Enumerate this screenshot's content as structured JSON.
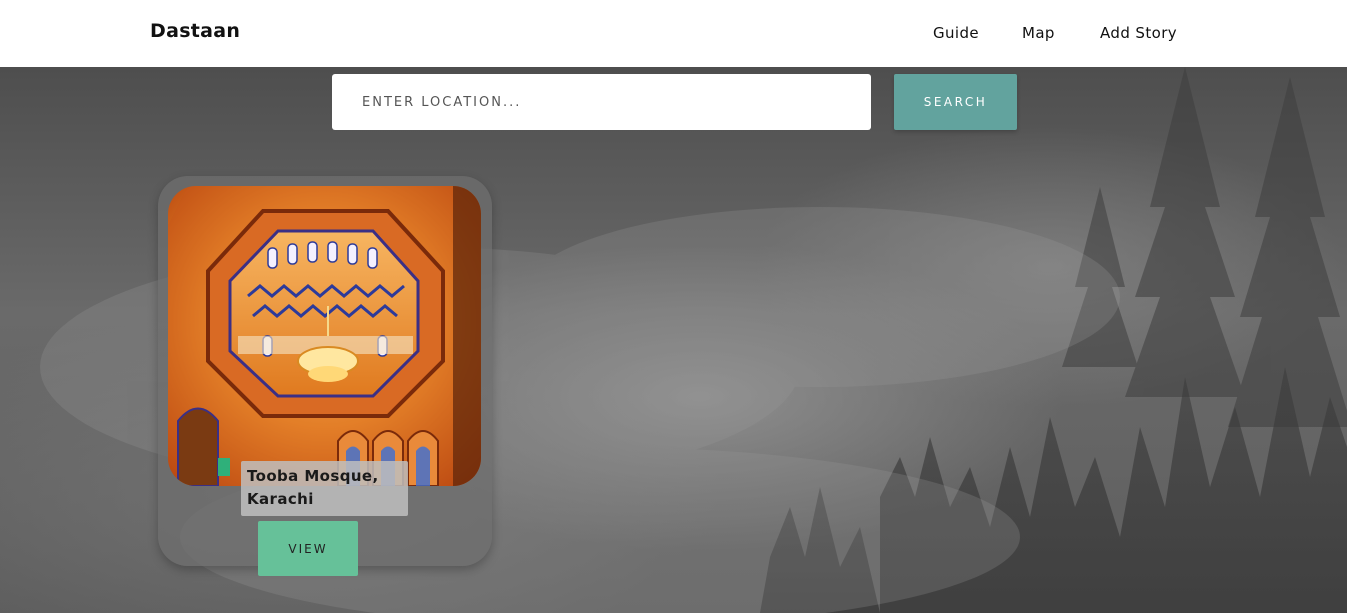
{
  "navbar": {
    "brand": "Dastaan",
    "links": [
      {
        "label": "Guide"
      },
      {
        "label": "Map"
      },
      {
        "label": "Add Story"
      }
    ]
  },
  "search": {
    "placeholder": "ENTER LOCATION...",
    "value": "",
    "button_label": "SEARCH"
  },
  "stories": [
    {
      "title": "Tooba Mosque, Karachi",
      "view_label": "VIEW"
    }
  ],
  "colors": {
    "search_button": "#62a39e",
    "view_button": "#66c199",
    "navbar_bg": "#ffffff"
  }
}
